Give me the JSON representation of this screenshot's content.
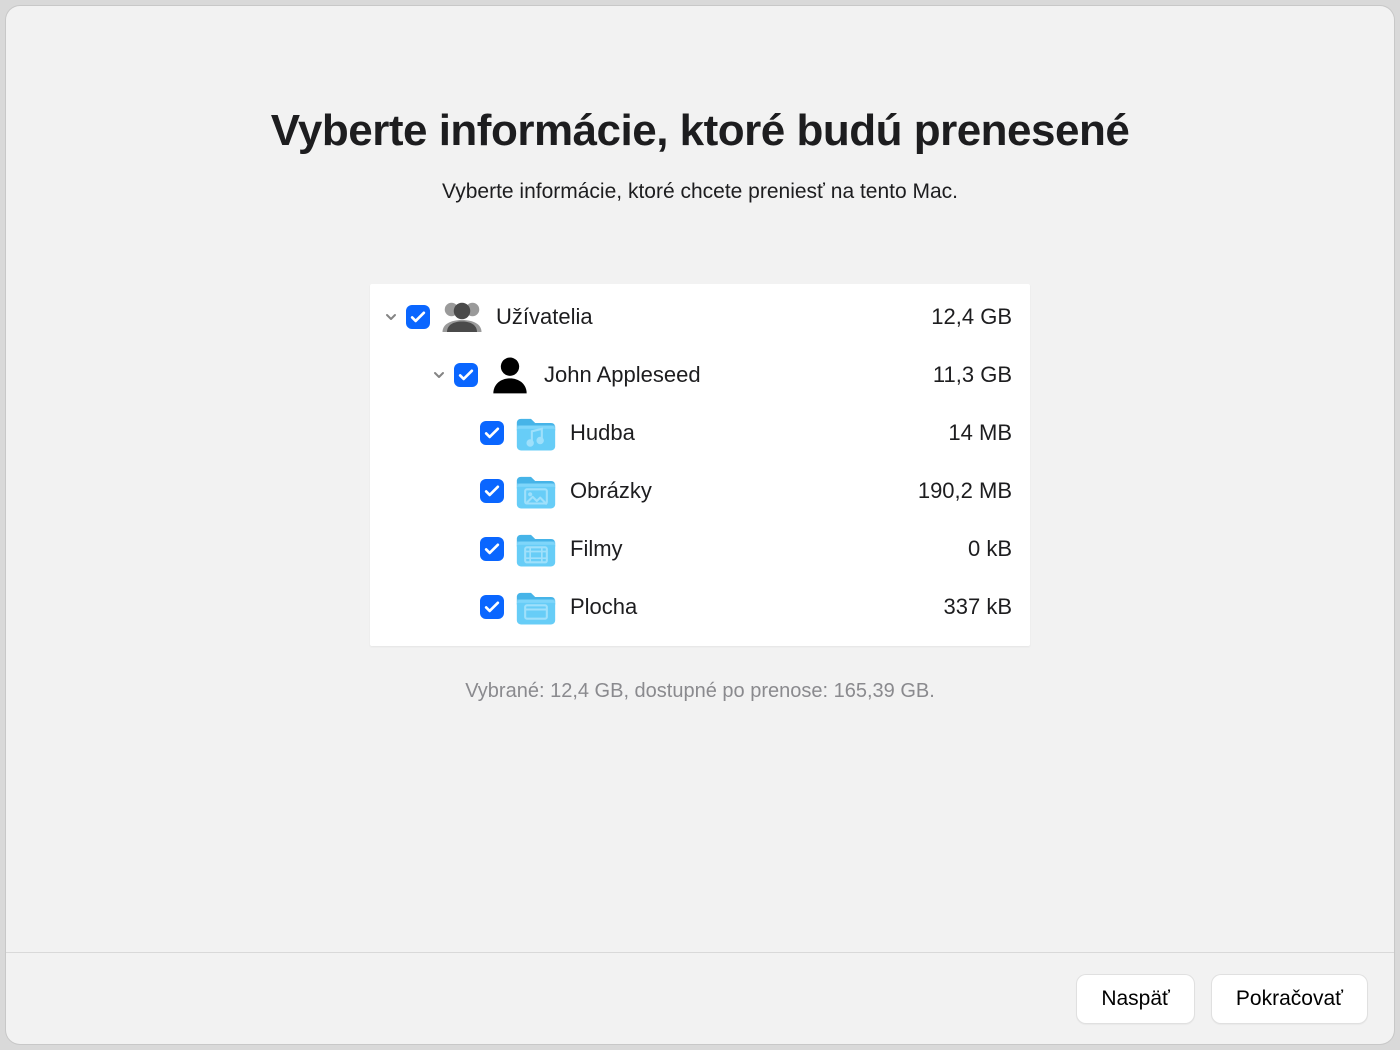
{
  "title": "Vyberte informácie, ktoré budú prenesené",
  "subtitle": "Vyberte informácie, ktoré chcete preniesť na tento Mac.",
  "rows": {
    "users": {
      "label": "Užívatelia",
      "size": "12,4 GB"
    },
    "john": {
      "label": "John Appleseed",
      "size": "11,3 GB"
    },
    "music": {
      "label": "Hudba",
      "size": "14 MB"
    },
    "images": {
      "label": "Obrázky",
      "size": "190,2 MB"
    },
    "movies": {
      "label": "Filmy",
      "size": "0 kB"
    },
    "desktop": {
      "label": "Plocha",
      "size": "337 kB"
    }
  },
  "summary": "Vybrané: 12,4 GB, dostupné po prenose: 165,39 GB.",
  "buttons": {
    "back": "Naspäť",
    "continue": "Pokračovať"
  }
}
